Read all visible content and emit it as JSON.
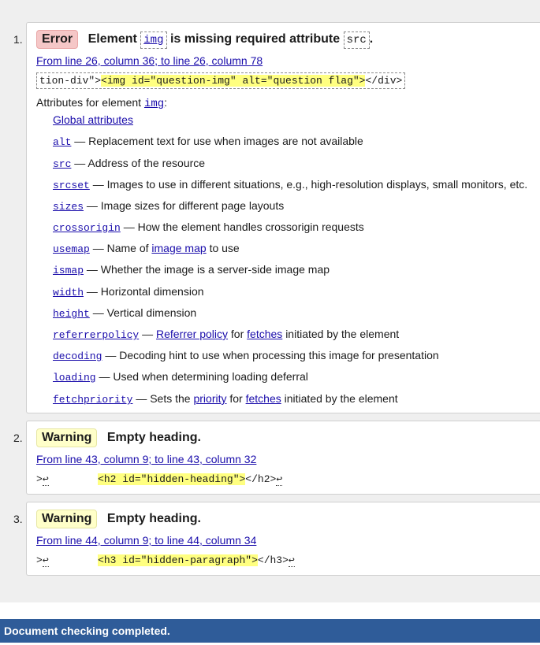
{
  "messages": [
    {
      "number": "1.",
      "badge": "Error",
      "text_before": "Element",
      "code1": "img",
      "text_middle": "is missing required attribute",
      "code2": "src",
      "text_after": ".",
      "location": "From line 26, column 36; to line 26, column 78",
      "extract": {
        "before": "tion-div\">",
        "highlight": "<img id=\"question-img\" alt=\"question flag\">",
        "after": "</div>"
      },
      "attrs_label": "Attributes for element",
      "attrs_element": "img",
      "attrs_colon": ":",
      "global_attributes": "Global attributes",
      "attributes": [
        {
          "name": "alt",
          "desc": "— Replacement text for use when images are not available"
        },
        {
          "name": "src",
          "desc": "— Address of the resource"
        },
        {
          "name": "srcset",
          "desc": "— Images to use in different situations, e.g., high-resolution displays, small monitors, etc."
        },
        {
          "name": "sizes",
          "desc": "— Image sizes for different page layouts"
        },
        {
          "name": "crossorigin",
          "desc": "— How the element handles crossorigin requests"
        },
        {
          "name": "usemap",
          "desc_pre": "— Name of",
          "link": "image map",
          "desc_post": "to use"
        },
        {
          "name": "ismap",
          "desc": "— Whether the image is a server-side image map"
        },
        {
          "name": "width",
          "desc": "— Horizontal dimension"
        },
        {
          "name": "height",
          "desc": "— Vertical dimension"
        },
        {
          "name": "referrerpolicy",
          "desc_pre": "—",
          "link": "Referrer policy",
          "desc_mid": "for",
          "link2": "fetches",
          "desc_post": "initiated by the element"
        },
        {
          "name": "decoding",
          "desc": "— Decoding hint to use when processing this image for presentation"
        },
        {
          "name": "loading",
          "desc": "— Used when determining loading deferral"
        },
        {
          "name": "fetchpriority",
          "desc_pre": "— Sets the",
          "link": "priority",
          "desc_mid": "for",
          "link2": "fetches",
          "desc_post": "initiated by the element"
        }
      ]
    },
    {
      "number": "2.",
      "badge": "Warning",
      "text": "Empty heading.",
      "location": "From line 43, column 9; to line 43, column 32",
      "extract": {
        "before": ">",
        "lf1": "↩",
        "spaces": "        ",
        "highlight": "<h2 id=\"hidden-heading\">",
        "after": "</h2>",
        "lf2": "↩"
      }
    },
    {
      "number": "3.",
      "badge": "Warning",
      "text": "Empty heading.",
      "location": "From line 44, column 9; to line 44, column 34",
      "extract": {
        "before": ">",
        "lf1": "↩",
        "spaces": "        ",
        "highlight": "<h3 id=\"hidden-paragraph\">",
        "after": "</h3>",
        "lf2": "↩"
      }
    }
  ],
  "status": "Document checking completed."
}
